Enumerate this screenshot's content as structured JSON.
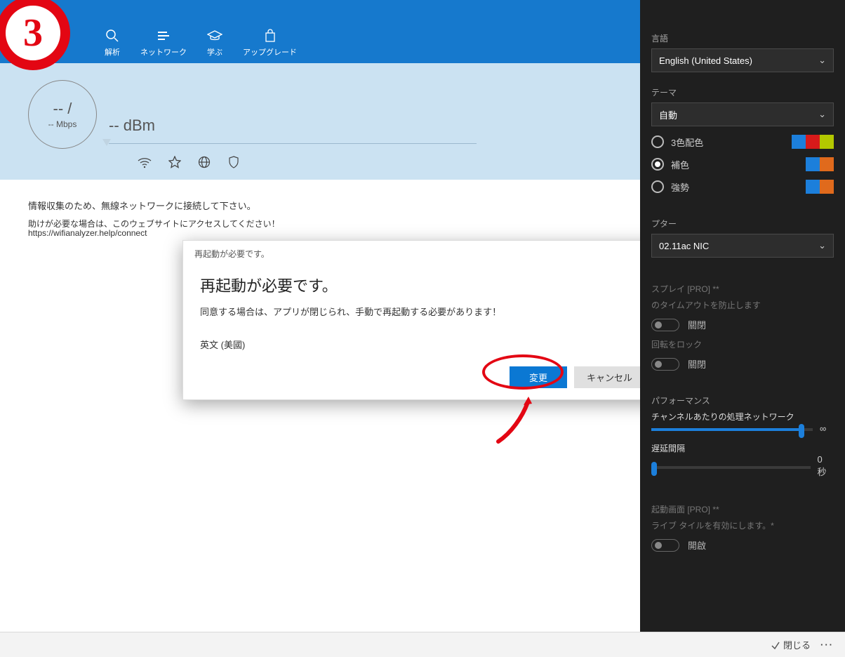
{
  "annotation": {
    "step_number": "3"
  },
  "titlebar": {
    "minimize": "—",
    "maximize": "▢",
    "close": "✕"
  },
  "toolbar": {
    "items": [
      {
        "label": "解析"
      },
      {
        "label": "ネットワーク"
      },
      {
        "label": "学ぶ"
      },
      {
        "label": "アップグレード"
      }
    ]
  },
  "signal": {
    "ratio": "-- /",
    "mbps": "-- Mbps",
    "dbm": "-- dBm"
  },
  "messages": {
    "connect": "情報収集のため、無線ネットワークに接続して下さい。",
    "help": "助けが必要な場合は、このウェブサイトにアクセスしてください！",
    "help_url": "https://wifianalyzer.help/connect"
  },
  "dialog": {
    "caption": "再起動が必要です。",
    "heading": "再起動が必要です。",
    "body": "同意する場合は、アプリが閉じられ、手動で再起動する必要があります！",
    "lang_line": "英文 (美國)",
    "primary": "変更",
    "secondary": "キャンセル"
  },
  "settings": {
    "language_label": "言語",
    "language_value": "English (United States)",
    "theme_label": "テーマ",
    "theme_value": "自動",
    "color_options": [
      {
        "name": "3色配色",
        "swatches": [
          "#1c7fdb",
          "#d71a1a",
          "#b3c800"
        ],
        "checked": false
      },
      {
        "name": "補色",
        "swatches": [
          "#1c7fdb",
          "#e06a1c"
        ],
        "checked": true
      },
      {
        "name": "強勢",
        "swatches": [
          "#1c7fdb",
          "#e06a1c"
        ],
        "checked": false
      }
    ],
    "adapter_label": "プター",
    "adapter_value": "02.11ac NIC",
    "display_label": "スプレイ [PRO] **",
    "timeout_prevent": "のタイムアウトを防止します",
    "rotation_lock": "回転をロック",
    "toggle_off": "關閉",
    "performance_label": "パフォーマンス",
    "channels_label": "チャンネルあたりの処理ネットワーク",
    "channels_value": "∞",
    "delay_label": "遅延間隔",
    "delay_value": "0 秒",
    "startup_label": "起動画面 [PRO] **",
    "livetile_label": "ライブ タイルを有効にします。*",
    "toggle_on": "開啟"
  },
  "bottombar": {
    "close": "閉じる",
    "more": "···"
  }
}
